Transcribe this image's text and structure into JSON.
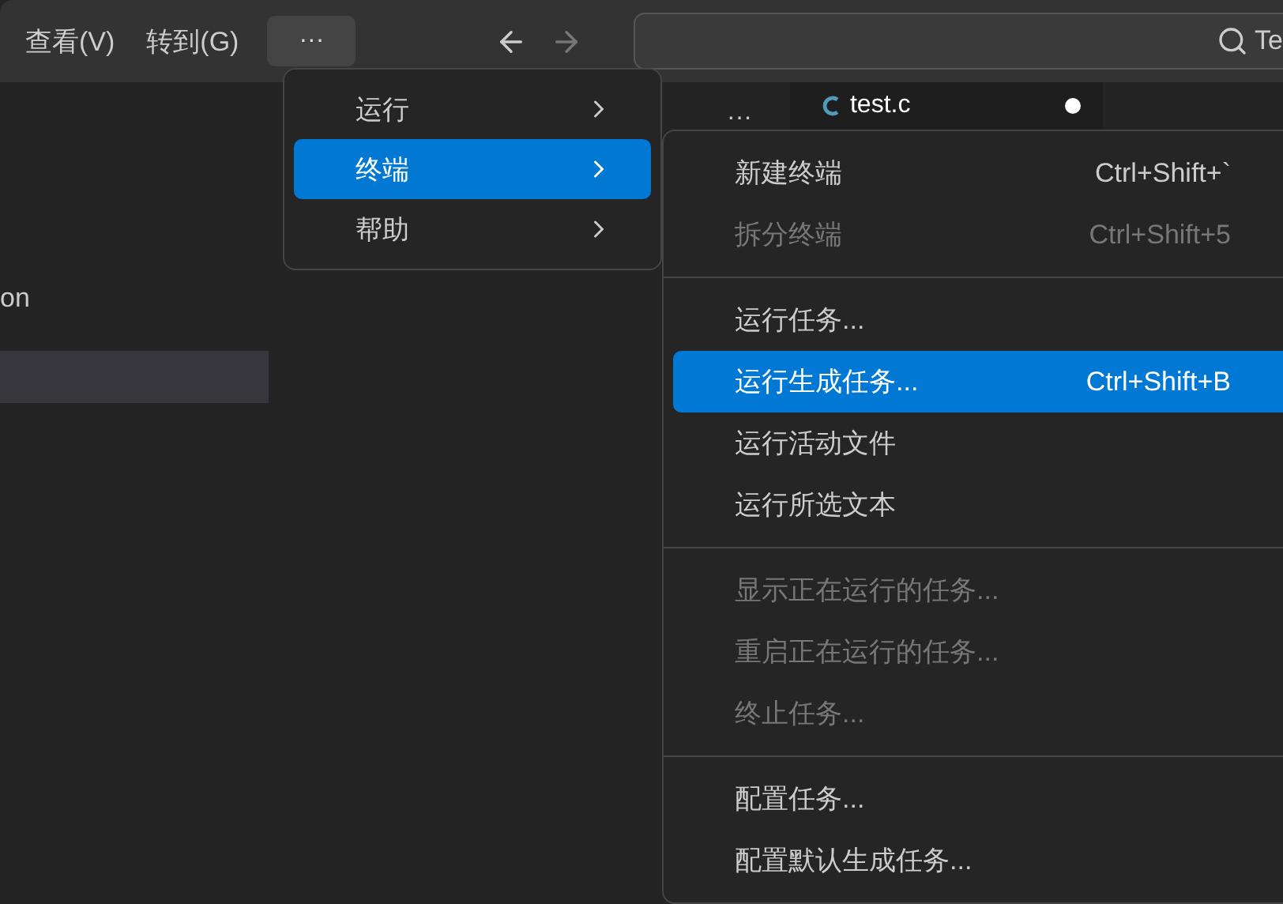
{
  "title_bar": {
    "menus": [
      "查看(V)",
      "转到(G)"
    ],
    "more_button": "···",
    "back_enabled": true,
    "forward_enabled": false,
    "search": {
      "value": "Te"
    }
  },
  "explorer": {
    "rows": [
      {
        "label": "on",
        "selected": false
      },
      {
        "selected": true
      }
    ]
  },
  "editor": {
    "more_button": "···",
    "tabs": [
      {
        "label": "test.c",
        "modified": true,
        "selected": true
      }
    ]
  },
  "menu": {
    "items": [
      {
        "label": "运行",
        "selected": false,
        "has_submenu": true
      },
      {
        "label": "终端",
        "selected": true,
        "has_submenu": true
      },
      {
        "label": "帮助",
        "selected": false,
        "has_submenu": true
      }
    ]
  },
  "submenu": {
    "groups": [
      [
        {
          "label": "新建终端",
          "shortcut": "Ctrl+Shift+`",
          "disabled": false,
          "selected": false
        },
        {
          "label": "拆分终端",
          "shortcut": "Ctrl+Shift+5",
          "disabled": true,
          "selected": false
        }
      ],
      [
        {
          "label": "运行任务...",
          "disabled": false,
          "selected": false
        },
        {
          "label": "运行生成任务...",
          "shortcut": "Ctrl+Shift+B",
          "disabled": false,
          "selected": true
        },
        {
          "label": "运行活动文件",
          "disabled": false,
          "selected": false
        },
        {
          "label": "运行所选文本",
          "disabled": false,
          "selected": false
        }
      ],
      [
        {
          "label": "显示正在运行的任务...",
          "disabled": true,
          "selected": false
        },
        {
          "label": "重启正在运行的任务...",
          "disabled": true,
          "selected": false
        },
        {
          "label": "终止任务...",
          "disabled": true,
          "selected": false
        }
      ],
      [
        {
          "label": "配置任务...",
          "disabled": false,
          "selected": false
        },
        {
          "label": "配置默认生成任务...",
          "disabled": false,
          "selected": false
        }
      ]
    ]
  }
}
